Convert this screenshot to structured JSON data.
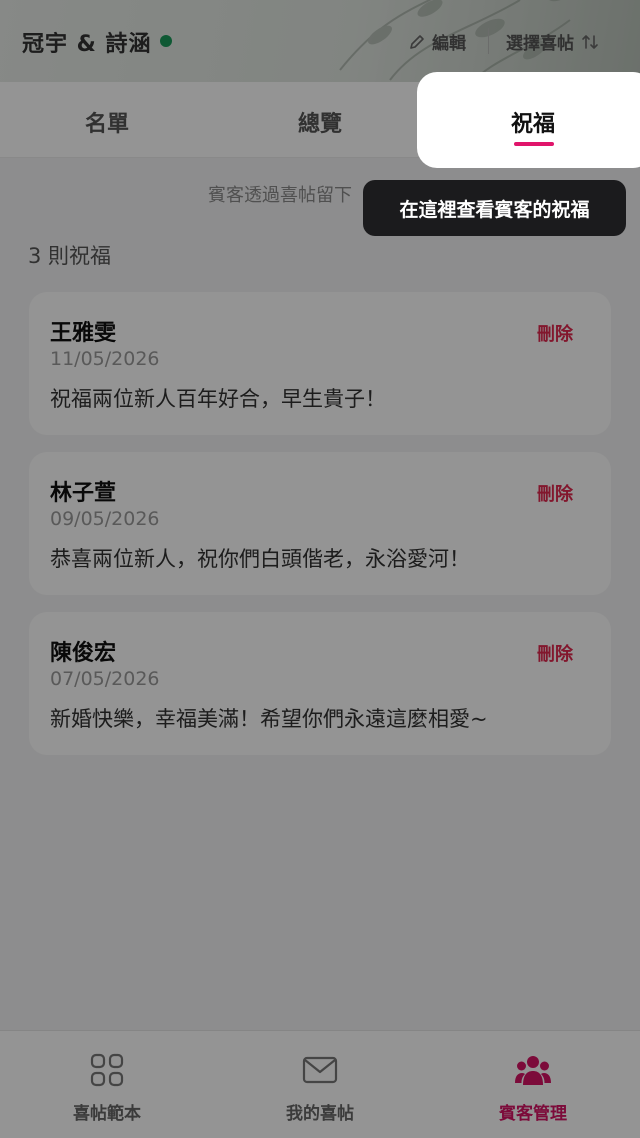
{
  "header": {
    "couple_name": "冠宇 & 詩涵",
    "edit_label": "編輯",
    "select_card_label": "選擇喜帖",
    "status_color": "#1b9a5a"
  },
  "tabs": [
    {
      "label": "名單"
    },
    {
      "label": "總覽"
    },
    {
      "label": "祝福",
      "active": true
    }
  ],
  "accent_color": "#e0156b",
  "subtitle": "賓客透過喜帖留下",
  "count_label": "3 則祝福",
  "wishes": [
    {
      "name": "王雅雯",
      "date": "11/05/2026",
      "message": "祝福兩位新人百年好合，早生貴子！",
      "delete_label": "刪除"
    },
    {
      "name": "林子萱",
      "date": "09/05/2026",
      "message": "恭喜兩位新人，祝你們白頭偕老，永浴愛河！",
      "delete_label": "刪除"
    },
    {
      "name": "陳俊宏",
      "date": "07/05/2026",
      "message": "新婚快樂，幸福美滿！希望你們永遠這麼相愛~",
      "delete_label": "刪除"
    }
  ],
  "tooltip": "在這裡查看賓客的祝福",
  "bottom_nav": [
    {
      "label": "喜帖範本",
      "icon": "grid-icon"
    },
    {
      "label": "我的喜帖",
      "icon": "envelope-icon"
    },
    {
      "label": "賓客管理",
      "icon": "people-icon",
      "active": true
    }
  ]
}
